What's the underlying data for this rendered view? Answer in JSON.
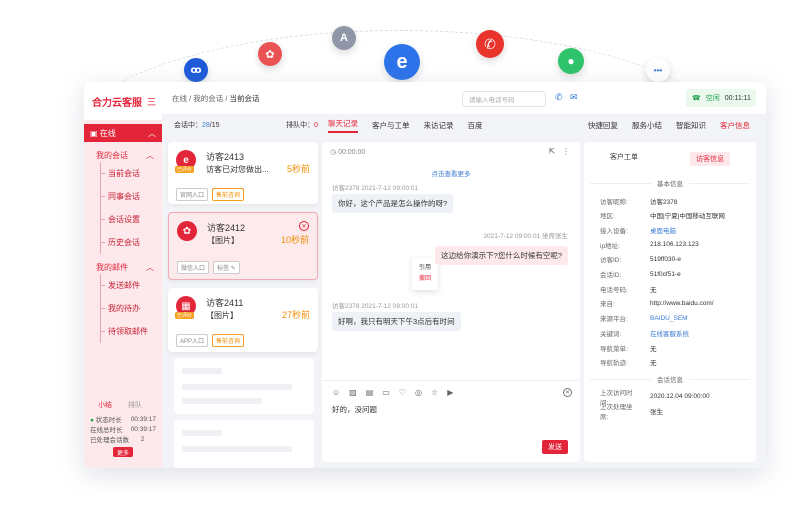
{
  "floating_icons": [
    {
      "name": "mini-program-icon",
      "glyph": "ꝏ",
      "color": "#1f5bd9"
    },
    {
      "name": "weibo-icon",
      "glyph": "✿",
      "color": "#e95353"
    },
    {
      "name": "appstore-icon",
      "glyph": "A",
      "color": "#8e96a8"
    },
    {
      "name": "ie-icon",
      "glyph": "e",
      "color": "#2c73ea"
    },
    {
      "name": "phone-icon",
      "glyph": "✆",
      "color": "#e8342b"
    },
    {
      "name": "wechat-icon",
      "glyph": "💬",
      "color": "#2fc36b"
    },
    {
      "name": "more-icon",
      "glyph": "•••",
      "color": "#ffffff"
    }
  ],
  "sidebar": {
    "brand": "合力云客服",
    "menu_icon": "三",
    "status": "在线",
    "groups": [
      {
        "label": "我的会话",
        "items": [
          "当前会话",
          "同事会话",
          "会话设置",
          "历史会话"
        ]
      },
      {
        "label": "我的邮件",
        "items": [
          "发送邮件",
          "我的待办",
          "待领取邮件"
        ]
      }
    ],
    "summary": {
      "tabs": [
        "小结",
        "排队"
      ],
      "rows": [
        {
          "label": "状态时长",
          "value": "00:39:17"
        },
        {
          "label": "在线总时长",
          "value": "00:39:17"
        },
        {
          "label": "已处理会话数",
          "value": "2"
        }
      ],
      "more": "更多"
    }
  },
  "topbar": {
    "breadcrumb": [
      "在线",
      "我的会话",
      "当前会话"
    ],
    "phone_placeholder": "请输入电话号码",
    "status": "空闲",
    "timer": "00:11:11"
  },
  "sessions": {
    "label": "会话中：",
    "count": "28",
    "total": "/15",
    "queue_label": "排队中：",
    "queue_count": "0",
    "cards": [
      {
        "name": "访客2413",
        "message": "访客已对您做出...",
        "time": "5秒前",
        "badge": "已评价",
        "tags": [
          "官网入口",
          "售前咨询"
        ]
      },
      {
        "name": "访客2412",
        "message": "【图片】",
        "time": "10秒前",
        "tags": [
          "微信入口",
          "标签"
        ]
      },
      {
        "name": "访客2411",
        "message": "【图片】",
        "time": "27秒前",
        "badge": "已评价",
        "tags": [
          "APP入口",
          "售前咨询"
        ]
      }
    ]
  },
  "chat": {
    "tabs": [
      "聊天记录",
      "客户与工单",
      "来访记录",
      "百度"
    ],
    "timer": "00:00:00",
    "load_more": "点击查看更多",
    "messages": [
      {
        "meta": "访客2378  2021-7-12 09:00:01",
        "text": "你好，这个产品是怎么操作的呀?"
      },
      {
        "meta": "2021-7-12 09:00:01  坐席张生",
        "text": "这边给你演示下?您什么时候有空呢?"
      },
      {
        "meta": "访客2378  2021-7-12 09:00:01",
        "text": "好啊，我只有明天下午3点后有时间"
      }
    ],
    "context_menu": [
      "引用",
      "撤回"
    ],
    "composer_text": "好的，没问题",
    "send": "发送"
  },
  "info": {
    "tabs": [
      "快捷回复",
      "服务小结",
      "智能知识",
      "客户信息"
    ],
    "subtabs": [
      "客户工单",
      "访客信息"
    ],
    "section_basic": "基本信息",
    "basic": [
      {
        "k": "访客昵称:",
        "v": "访客2378"
      },
      {
        "k": "地区:",
        "v": "中国|宁夏|中国移动互联网"
      },
      {
        "k": "接入设备:",
        "v": "桌面电脑",
        "link": true
      },
      {
        "k": "ip地址:",
        "v": "218.106.123.123"
      },
      {
        "k": "访客ID:",
        "v": "519ff030-e"
      },
      {
        "k": "会话ID:",
        "v": "51f0cf51-e"
      },
      {
        "k": "电话号码:",
        "v": "无"
      },
      {
        "k": "来自:",
        "v": "http://www.baidu.com/"
      },
      {
        "k": "来源平台:",
        "v": "BAIDU_SEM",
        "link": true
      },
      {
        "k": "关键词:",
        "v": "在线客服系统",
        "link": true
      },
      {
        "k": "导航菜单:",
        "v": "无"
      },
      {
        "k": "导航轨迹:",
        "v": "无"
      }
    ],
    "section_session": "会话信息",
    "session": [
      {
        "k": "上次访问时间:",
        "v": "2020.12.04 09:00:00"
      },
      {
        "k": "上次处理坐席:",
        "v": "张生"
      }
    ]
  }
}
